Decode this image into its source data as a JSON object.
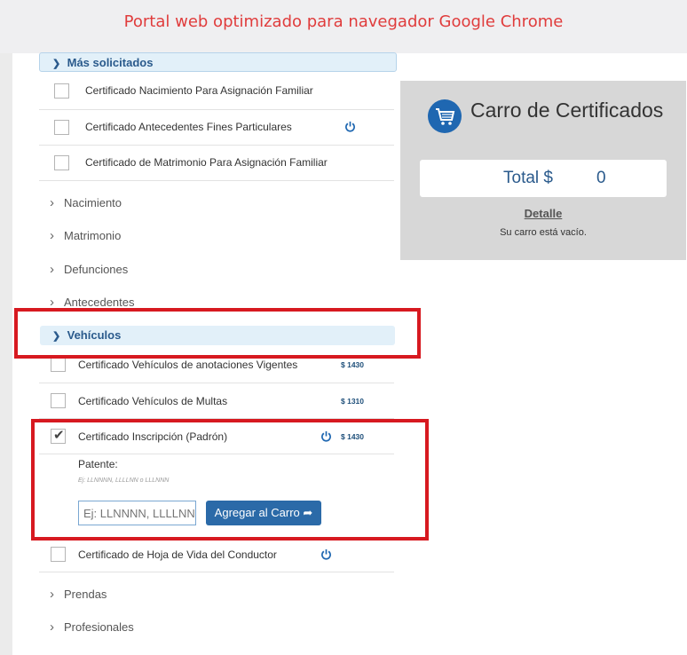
{
  "banner": {
    "text": "Portal web optimizado para navegador Google Chrome"
  },
  "categories": {
    "mas_solicitados": {
      "label": "Más solicitados",
      "items": [
        {
          "label": "Certificado Nacimiento Para Asignación Familiar"
        },
        {
          "label": "Certificado Antecedentes Fines Particulares"
        },
        {
          "label": "Certificado de Matrimonio Para Asignación Familiar"
        }
      ]
    },
    "collapsed_top": [
      "Nacimiento",
      "Matrimonio",
      "Defunciones",
      "Antecedentes"
    ],
    "vehiculos": {
      "label": "Vehículos",
      "items": [
        {
          "label": "Certificado Vehículos de anotaciones Vigentes",
          "price": "$ 1430"
        },
        {
          "label": "Certificado Vehículos de Multas",
          "price": "$ 1310"
        },
        {
          "label": "Certificado Inscripción (Padrón)",
          "price": "$ 1430",
          "checked": true
        },
        {
          "label": "Certificado de Hoja de Vida del Conductor"
        }
      ],
      "patente": {
        "label": "Patente:",
        "hint": "Ej: LLNNNN, LLLLNN o LLLNNN",
        "placeholder": "Ej: LLNNNN, LLLLNN o LLLNNN",
        "button": "Agregar al Carro"
      }
    },
    "collapsed_bottom": [
      "Prendas",
      "Profesionales"
    ]
  },
  "cart": {
    "title": "Carro de Certificados",
    "total_label": "Total $",
    "total_value": "0",
    "detalle": "Detalle",
    "empty": "Su carro está vacío."
  },
  "colors": {
    "accent": "#2b6aa8",
    "highlight": "#d71920",
    "banner_text": "#e03c3c"
  }
}
